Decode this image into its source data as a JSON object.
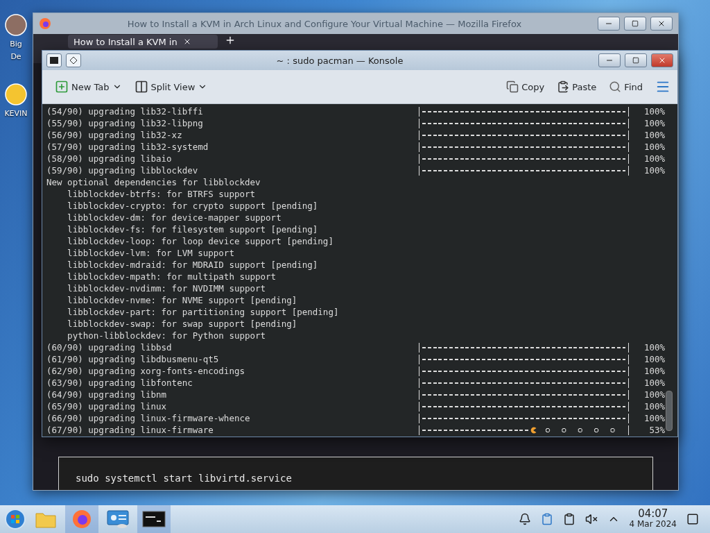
{
  "desktop_icons": [
    {
      "lines": [
        "Big",
        "De"
      ]
    },
    {
      "lines": [
        "KEVIN"
      ]
    }
  ],
  "browser": {
    "title": "How to Install a KVM in Arch Linux and Configure Your Virtual Machine — Mozilla Firefox",
    "tab": "How to Install a KVM in",
    "code": "sudo systemctl start libvirtd.service"
  },
  "konsole": {
    "title": "~ : sudo pacman — Konsole",
    "toolbar_left": [
      {
        "kind": "newtab",
        "label": "New Tab",
        "dropdown": true
      },
      {
        "kind": "split",
        "label": "Split View",
        "dropdown": true
      }
    ],
    "toolbar_right": [
      {
        "kind": "copy",
        "label": "Copy"
      },
      {
        "kind": "paste",
        "label": "Paste"
      },
      {
        "kind": "find",
        "label": "Find"
      },
      {
        "kind": "menu"
      }
    ],
    "lines": [
      {
        "kind": "progress",
        "text": "(54/90) upgrading lib32-libffi",
        "level": 1,
        "reading": "100%"
      },
      {
        "kind": "progress",
        "text": "(55/90) upgrading lib32-libpng",
        "level": 1,
        "reading": "100%"
      },
      {
        "kind": "progress",
        "text": "(56/90) upgrading lib32-xz",
        "level": 1,
        "reading": "100%"
      },
      {
        "kind": "progress",
        "text": "(57/90) upgrading lib32-systemd",
        "level": 1,
        "reading": "100%"
      },
      {
        "kind": "progress",
        "text": "(58/90) upgrading libaio",
        "level": 1,
        "reading": "100%"
      },
      {
        "kind": "progress",
        "text": "(59/90) upgrading libblockdev",
        "level": 1,
        "reading": "100%"
      },
      {
        "kind": "text",
        "text": "New optional dependencies for libblockdev"
      },
      {
        "kind": "text",
        "text": "    libblockdev-btrfs: for BTRFS support"
      },
      {
        "kind": "text",
        "text": "    libblockdev-crypto: for crypto support [pending]"
      },
      {
        "kind": "text",
        "text": "    libblockdev-dm: for device-mapper support"
      },
      {
        "kind": "text",
        "text": "    libblockdev-fs: for filesystem support [pending]"
      },
      {
        "kind": "text",
        "text": "    libblockdev-loop: for loop device support [pending]"
      },
      {
        "kind": "text",
        "text": "    libblockdev-lvm: for LVM support"
      },
      {
        "kind": "text",
        "text": "    libblockdev-mdraid: for MDRAID support [pending]"
      },
      {
        "kind": "text",
        "text": "    libblockdev-mpath: for multipath support"
      },
      {
        "kind": "text",
        "text": "    libblockdev-nvdimm: for NVDIMM support"
      },
      {
        "kind": "text",
        "text": "    libblockdev-nvme: for NVME support [pending]"
      },
      {
        "kind": "text",
        "text": "    libblockdev-part: for partitioning support [pending]"
      },
      {
        "kind": "text",
        "text": "    libblockdev-swap: for swap support [pending]"
      },
      {
        "kind": "text",
        "text": "    python-libblockdev: for Python support"
      },
      {
        "kind": "progress",
        "text": "(60/90) upgrading libbsd",
        "level": 1,
        "reading": "100%"
      },
      {
        "kind": "progress",
        "text": "(61/90) upgrading libdbusmenu-qt5",
        "level": 1,
        "reading": "100%"
      },
      {
        "kind": "progress",
        "text": "(62/90) upgrading xorg-fonts-encodings",
        "level": 1,
        "reading": "100%"
      },
      {
        "kind": "progress",
        "text": "(63/90) upgrading libfontenc",
        "level": 1,
        "reading": "100%"
      },
      {
        "kind": "progress",
        "text": "(64/90) upgrading libnm",
        "level": 1,
        "reading": "100%"
      },
      {
        "kind": "progress",
        "text": "(65/90) upgrading linux",
        "level": 1,
        "reading": "100%"
      },
      {
        "kind": "progress",
        "text": "(66/90) upgrading linux-firmware-whence",
        "level": 1,
        "reading": "100%"
      },
      {
        "kind": "progress",
        "text": "(67/90) upgrading linux-firmware",
        "level": 0.53,
        "reading": "53%"
      }
    ]
  },
  "taskbar": {
    "apps": [
      {
        "kind": "folder",
        "active": false
      },
      {
        "kind": "firefox",
        "active": true
      },
      {
        "kind": "settings",
        "active": false
      },
      {
        "kind": "terminal",
        "active": true
      }
    ],
    "time": "04:07",
    "date": "4 Mar 2024"
  }
}
